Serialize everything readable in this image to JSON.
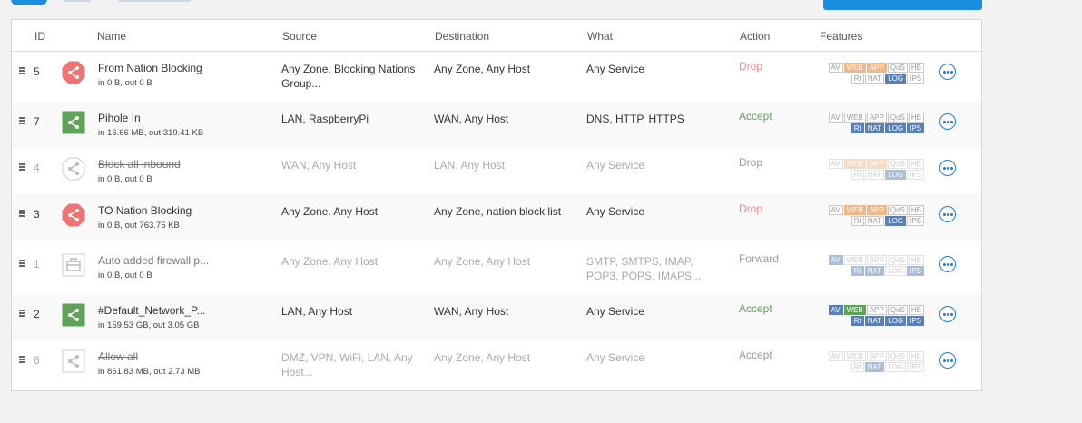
{
  "header": {
    "id": "ID",
    "name": "Name",
    "source": "Source",
    "destination": "Destination",
    "what": "What",
    "action": "Action",
    "features": "Features"
  },
  "rules": [
    {
      "id": "5",
      "name": "From Nation Blocking",
      "traffic": "in 0 B, out 0 B",
      "source": "Any Zone, Blocking Nations Group...",
      "destination": "Any Zone, Any Host",
      "what": "Any Service",
      "action": "Drop",
      "icon": "stop-icon",
      "enabled": true
    },
    {
      "id": "7",
      "name": "Pihole In",
      "traffic": "in 16.66 MB, out 319.41 KB",
      "source": "LAN, RaspberryPi",
      "destination": "WAN, Any Host",
      "what": "DNS, HTTP, HTTPS",
      "action": "Accept",
      "icon": "share-icon",
      "enabled": true
    },
    {
      "id": "4",
      "name": "Block all inbound",
      "traffic": "in 0 B, out 0 B",
      "source": "WAN, Any Host",
      "destination": "LAN, Any Host",
      "what": "Any Service",
      "action": "Drop",
      "icon": "share-icon",
      "enabled": false
    },
    {
      "id": "3",
      "name": "TO Nation Blocking",
      "traffic": "in 0 B, out 763.75 KB",
      "source": "Any Zone, Any Host",
      "destination": "Any Zone, nation block list",
      "what": "Any Service",
      "action": "Drop",
      "icon": "stop-icon",
      "enabled": true
    },
    {
      "id": "1",
      "name": "Auto added firewall p...",
      "traffic": "in 0 B, out 0 B",
      "source": "Any Zone, Any Host",
      "destination": "Any Zone, Any Host",
      "what": "SMTP, SMTPS, IMAP, POP3, POPS, IMAPS...",
      "action": "Forward",
      "icon": "briefcase-icon",
      "enabled": false
    },
    {
      "id": "2",
      "name": "#Default_Network_P...",
      "traffic": "in 159.53 GB, out 3.05 GB",
      "source": "LAN, Any Host",
      "destination": "WAN, Any Host",
      "what": "Any Service",
      "action": "Accept",
      "icon": "share-icon",
      "enabled": true
    },
    {
      "id": "6",
      "name": "Allow all",
      "traffic": "in 861.83 MB, out 2.73 MB",
      "source": "DMZ, VPN, WiFi, LAN, Any Host...",
      "destination": "Any Zone, Any Host",
      "what": "Any Service",
      "action": "Accept",
      "icon": "share-icon",
      "enabled": false
    }
  ],
  "feature_labels": {
    "av": "AV",
    "web": "WEB",
    "app": "APP",
    "qos": "QoS",
    "hb": "HB",
    "rt": "Rt",
    "nat": "NAT",
    "log": "LOG",
    "ips": "IPS"
  },
  "colors": {
    "drop": "#f08a8a",
    "accept": "#5fa35a",
    "accent": "#1a8fe0",
    "tag_blue": "#5a7fb4",
    "tag_orange": "#f0b889",
    "tag_green": "#5fa35a"
  }
}
